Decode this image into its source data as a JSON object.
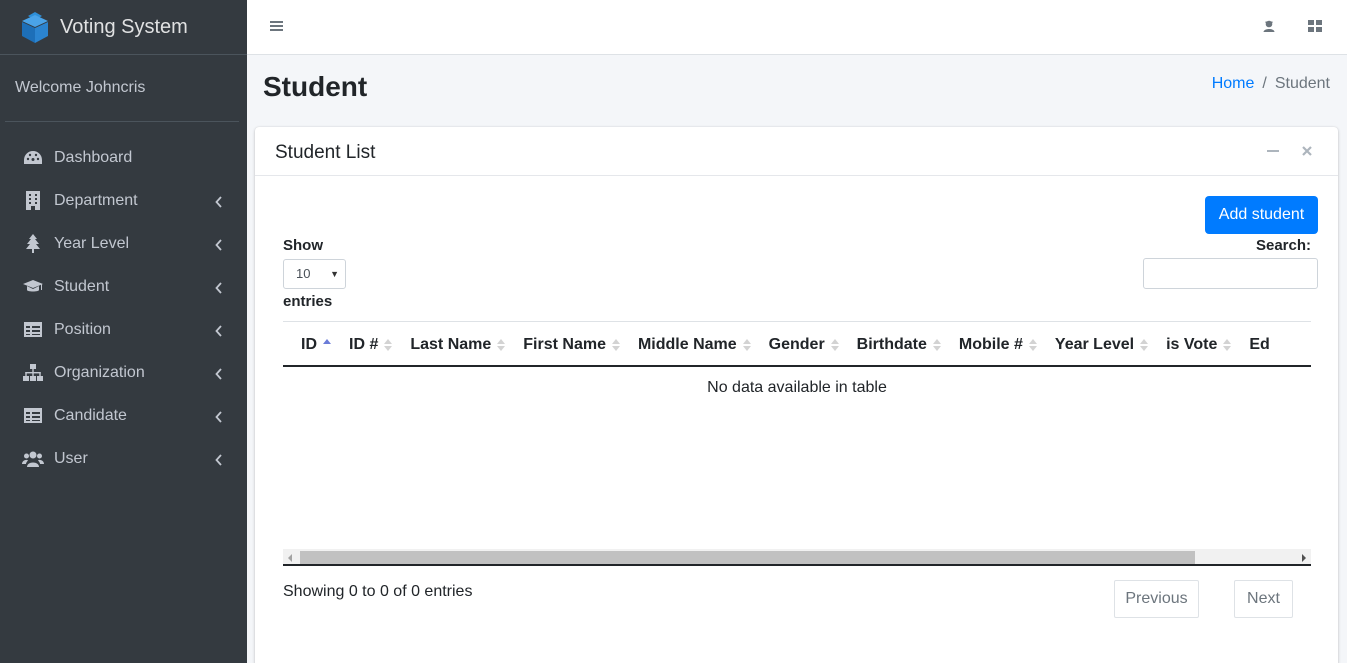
{
  "brand": {
    "title": "Voting System"
  },
  "sidebar": {
    "welcome": "Welcome Johncris",
    "items": [
      {
        "label": "Dashboard",
        "icon": "dashboard-icon",
        "has_arrow": false
      },
      {
        "label": "Department",
        "icon": "building-icon",
        "has_arrow": true
      },
      {
        "label": "Year Level",
        "icon": "tree-icon",
        "has_arrow": true
      },
      {
        "label": "Student",
        "icon": "graduation-cap-icon",
        "has_arrow": true
      },
      {
        "label": "Position",
        "icon": "table-icon",
        "has_arrow": true
      },
      {
        "label": "Organization",
        "icon": "sitemap-icon",
        "has_arrow": true
      },
      {
        "label": "Candidate",
        "icon": "table-icon",
        "has_arrow": true
      },
      {
        "label": "User",
        "icon": "users-icon",
        "has_arrow": true
      }
    ]
  },
  "header": {
    "page_title": "Student",
    "breadcrumb": {
      "home": "Home",
      "separator": "/",
      "current": "Student"
    }
  },
  "card": {
    "title": "Student List",
    "add_button": "Add student",
    "show_label": "Show",
    "length_value": "10",
    "entries_label": "entries",
    "search_label": "Search:",
    "search_value": "",
    "columns": [
      "ID",
      "ID #",
      "Last Name",
      "First Name",
      "Middle Name",
      "Gender",
      "Birthdate",
      "Mobile #",
      "Year Level",
      "is Vote",
      "Ed"
    ],
    "empty_message": "No data available in table",
    "info": "Showing 0 to 0 of 0 entries",
    "prev_label": "Previous",
    "next_label": "Next"
  },
  "colors": {
    "sidebar_bg": "#343a40",
    "accent": "#007bff",
    "page_bg": "#f4f6f9"
  }
}
